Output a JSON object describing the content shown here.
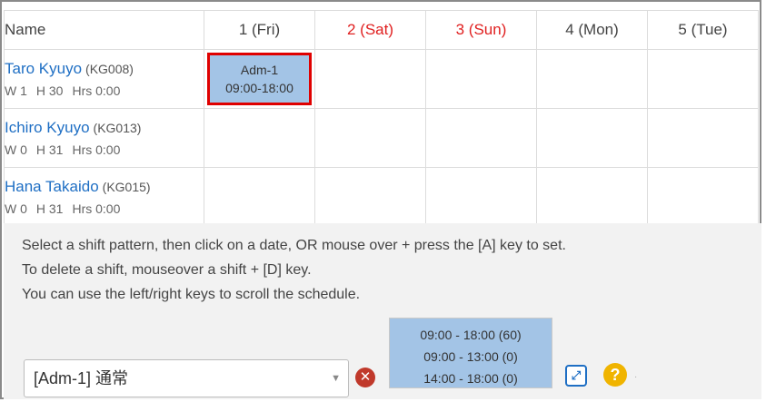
{
  "header": {
    "name_label": "Name",
    "days": [
      {
        "label": "1 (Fri)",
        "weekend": false
      },
      {
        "label": "2 (Sat)",
        "weekend": true
      },
      {
        "label": "3 (Sun)",
        "weekend": true
      },
      {
        "label": "4 (Mon)",
        "weekend": false
      },
      {
        "label": "5 (Tue)",
        "weekend": false
      }
    ]
  },
  "employees": [
    {
      "name": "Taro Kyuyo",
      "code": "(KG008)",
      "w": "W 1",
      "h": "H 30",
      "hrs": "Hrs 0:00",
      "shift": {
        "code": "Adm-1",
        "time": "09:00-18:00"
      }
    },
    {
      "name": "Ichiro Kyuyo",
      "code": "(KG013)",
      "w": "W 0",
      "h": "H 31",
      "hrs": "Hrs 0:00"
    },
    {
      "name": "Hana Takaido",
      "code": "(KG015)",
      "w": "W 0",
      "h": "H 31",
      "hrs": "Hrs 0:00"
    }
  ],
  "instructions": {
    "line1": "Select a shift pattern, then click on a date, OR mouse over + press the [A] key to set.",
    "line2": "To delete a shift, mouseover a shift + [D] key.",
    "line3": "You can use the left/right keys to scroll the schedule."
  },
  "shift_select": {
    "value": "[Adm-1] 通常"
  },
  "time_options": [
    "09:00 - 18:00 (60)",
    "09:00 - 13:00 (0)",
    "14:00 - 18:00 (0)"
  ],
  "colors": {
    "shift_fill": "#a3c4e6",
    "highlight": "#e00000",
    "weekend": "#e02020",
    "link": "#1f6fc4"
  },
  "icons": {
    "clear": "x-circle-icon",
    "expand": "expand-icon",
    "help": "question-icon"
  }
}
